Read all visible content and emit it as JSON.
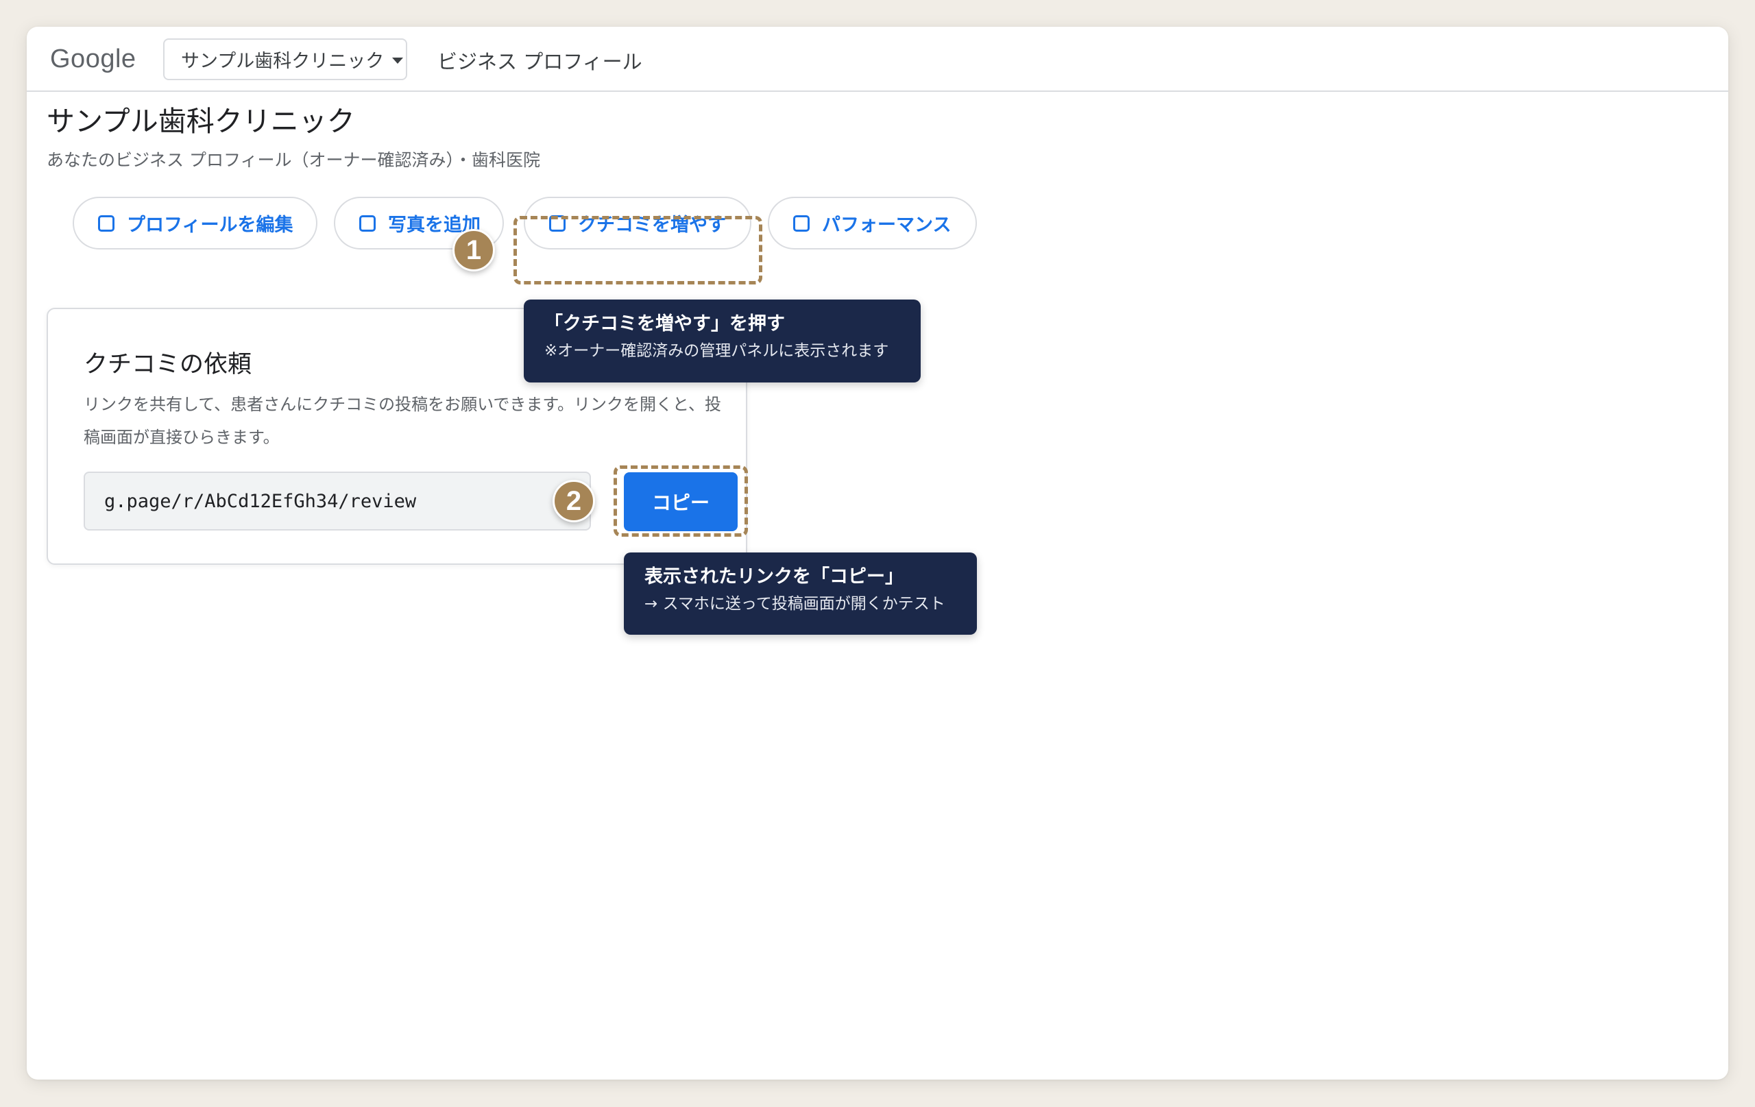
{
  "topbar": {
    "logo": "Google",
    "business_select": "サンプル歯科クリニック",
    "product_name": "ビジネス プロフィール"
  },
  "page": {
    "title": "サンプル歯科クリニック",
    "subtitle": "あなたのビジネス プロフィール（オーナー確認済み）・歯科医院"
  },
  "actions": [
    {
      "label": "プロフィールを編集",
      "icon": "square-outline-icon"
    },
    {
      "label": "写真を追加",
      "icon": "square-outline-icon"
    },
    {
      "label": "クチコミを増やす",
      "icon": "square-outline-icon"
    },
    {
      "label": "パフォーマンス",
      "icon": "square-outline-icon"
    }
  ],
  "review_card": {
    "title": "クチコミの依頼",
    "description": "リンクを共有して、患者さんにクチコミの投稿をお願いできます。リンクを開くと、投稿画面が直接ひらきます。",
    "link": "g.page/r/AbCd12EfGh34/review",
    "copy_label": "コピー"
  },
  "annotations": [
    {
      "number": "1",
      "title": "「クチコミを増やす」を押す",
      "subtitle": "※オーナー確認済みの管理パネルに表示されます"
    },
    {
      "number": "2",
      "title": "表示されたリンクを「コピー」",
      "subtitle": "→ スマホに送って投稿画面が開くかテスト"
    }
  ],
  "colors": {
    "accent": "#1a73e8",
    "highlight": "#a68556",
    "tooltip_bg": "#1b2849",
    "background": "#f1ede6"
  }
}
